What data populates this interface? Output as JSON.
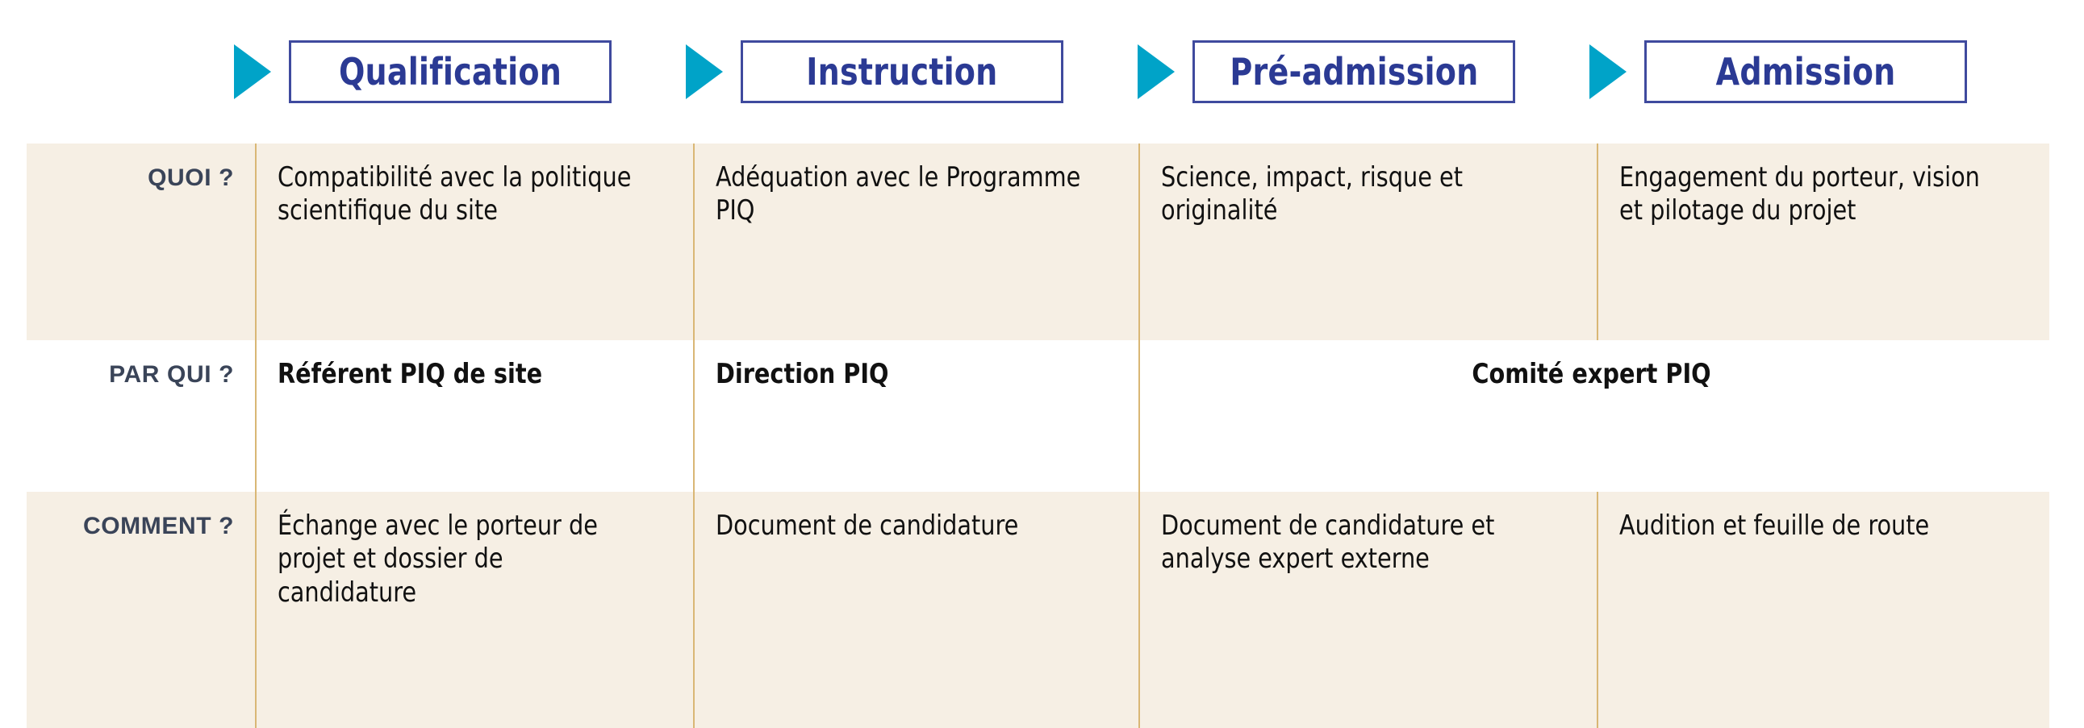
{
  "stages": [
    {
      "label": "Qualification",
      "arrow_icon": "triangle-right-icon"
    },
    {
      "label": "Instruction",
      "arrow_icon": "triangle-right-icon"
    },
    {
      "label": "Pré-admission",
      "arrow_icon": "triangle-right-icon"
    },
    {
      "label": "Admission",
      "arrow_icon": "triangle-right-icon"
    }
  ],
  "rows": [
    {
      "label": "QUOI ?",
      "cells": [
        "Compatibilité avec la politique scientifique du site",
        "Adéquation avec le Programme PIQ",
        "Science, impact, risque et originalité",
        "Engagement du porteur, vision et pilotage du projet"
      ]
    },
    {
      "label": "PAR QUI ?",
      "cells": [
        "Référent PIQ de site",
        "Direction PIQ",
        "Comité expert PIQ"
      ]
    },
    {
      "label": "COMMENT ?",
      "cells": [
        "Échange avec le porteur de projet et dossier de candidature",
        "Document de candidature",
        "Document de candidature et analyse expert externe",
        "Audition et feuille de route"
      ]
    }
  ],
  "colors": {
    "arrow": "#00A3C8",
    "stage_border": "#3F4A9E",
    "stage_text": "#2B3A94",
    "row_shaded_bg": "#F6EFE4",
    "row_plain_bg": "#FFFFFF",
    "column_separator": "#D9B775",
    "row_label_text": "#3A4458",
    "cell_text": "#111111"
  }
}
